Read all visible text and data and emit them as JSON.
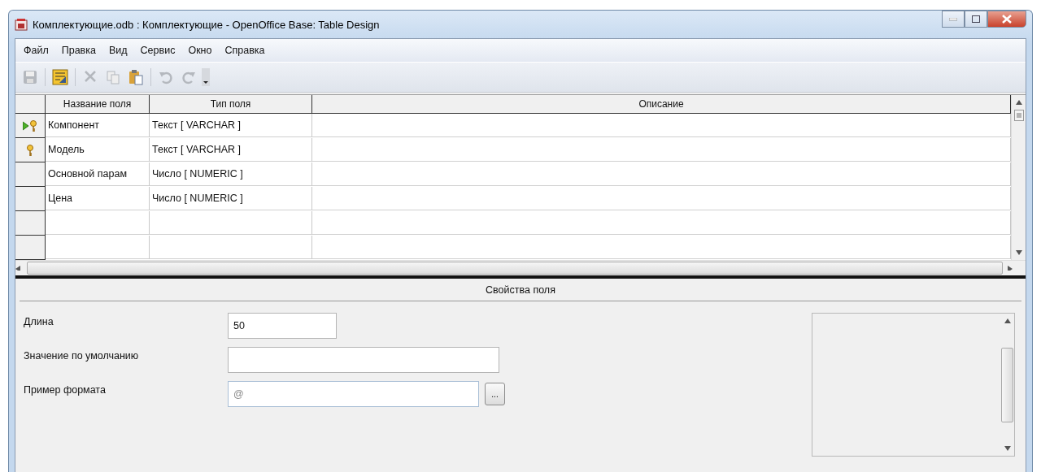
{
  "window": {
    "title": "Комплектующие.odb : Комплектующие - OpenOffice Base: Table Design"
  },
  "menu": [
    {
      "label": "Файл"
    },
    {
      "label": "Правка"
    },
    {
      "label": "Вид"
    },
    {
      "label": "Сервис"
    },
    {
      "label": "Окно"
    },
    {
      "label": "Справка"
    }
  ],
  "toolbar": [
    {
      "kind": "save",
      "disabled": true
    },
    {
      "kind": "sep"
    },
    {
      "kind": "design",
      "disabled": false
    },
    {
      "kind": "sep"
    },
    {
      "kind": "cut",
      "disabled": true
    },
    {
      "kind": "copy",
      "disabled": true
    },
    {
      "kind": "paste",
      "disabled": false
    },
    {
      "kind": "sep"
    },
    {
      "kind": "undo",
      "disabled": true
    },
    {
      "kind": "redo",
      "disabled": true
    }
  ],
  "table": {
    "columns": [
      "Название поля",
      "Тип поля",
      "Описание"
    ],
    "rows": [
      {
        "name": "Компонент",
        "type": "Текст [ VARCHAR ]",
        "primary_key": true,
        "current": true
      },
      {
        "name": "Модель",
        "type": "Текст [ VARCHAR ]",
        "primary_key": true,
        "current": false
      },
      {
        "name": "Основной парам",
        "type": "Число [ NUMERIC ]",
        "primary_key": false,
        "current": false
      },
      {
        "name": "Цена",
        "type": "Число [ NUMERIC ]",
        "primary_key": false,
        "current": false
      }
    ]
  },
  "properties": {
    "title": "Свойства поля",
    "fields": [
      {
        "label": "Длина",
        "value": "50",
        "disabled": false,
        "has_button": false
      },
      {
        "label": "Значение по умолчанию",
        "disabled": false,
        "has_button": false
      },
      {
        "label": "Пример формата",
        "value": "@",
        "disabled": true,
        "has_button": true,
        "button": "..."
      }
    ]
  }
}
